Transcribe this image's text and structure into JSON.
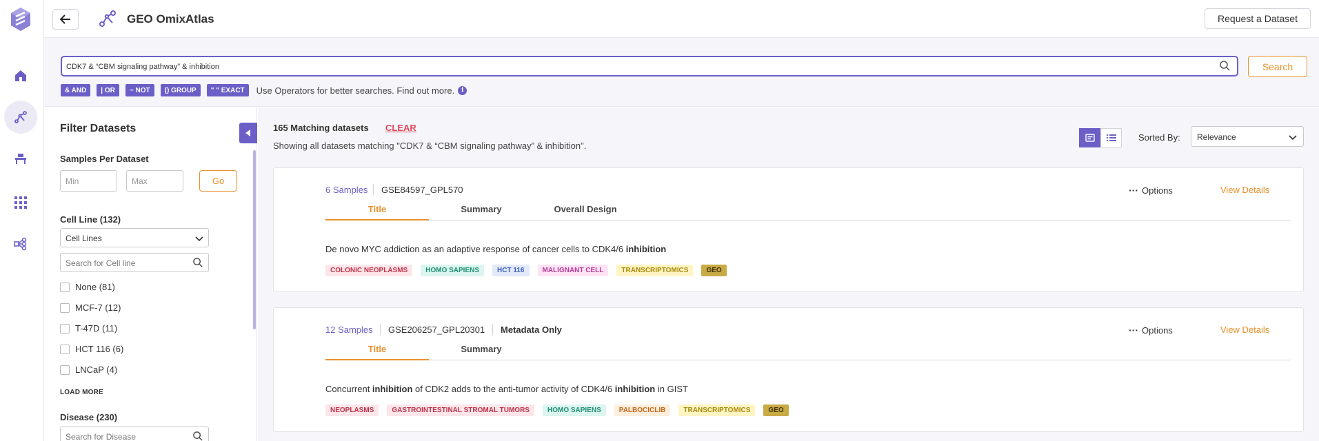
{
  "app": {
    "title": "GEO OmixAtlas",
    "request_label": "Request a Dataset"
  },
  "search": {
    "query": "CDK7 & “CBM signaling pathway” & inhibition",
    "button_label": "Search",
    "operators": [
      "& AND",
      "| OR",
      "~ NOT",
      "() GROUP",
      "\" \" EXACT"
    ],
    "hint": "Use Operators for better searches. Find out more."
  },
  "filter": {
    "title": "Filter Datasets",
    "samples_label": "Samples Per Dataset",
    "min_placeholder": "Min",
    "max_placeholder": "Max",
    "go_label": "Go",
    "cell_line": {
      "label": "Cell Line (132)",
      "select_value": "Cell Lines",
      "search_placeholder": "Search for Cell line",
      "options": [
        "None (81)",
        "MCF-7 (12)",
        "T-47D (11)",
        "HCT 116 (6)",
        "LNCaP (4)"
      ]
    },
    "load_more": "LOAD MORE",
    "disease": {
      "label": "Disease (230)",
      "search_placeholder": "Search for Disease"
    }
  },
  "results": {
    "count_label": "165 Matching datasets",
    "clear_label": "CLEAR",
    "showing": "Showing all datasets matching \"CDK7 & “CBM signaling pathway” & inhibition\".",
    "sorted_by_label": "Sorted By:",
    "sort_value": "Relevance",
    "cards": [
      {
        "samples": "6 Samples",
        "gse": "GSE84597_GPL570",
        "options": "Options",
        "details": "View Details",
        "tabs": [
          "Title",
          "Summary",
          "Overall Design"
        ],
        "desc_pre": "De novo MYC addiction as an adaptive response of cancer cells to CDK4/6 ",
        "desc_bold": "inhibition",
        "tags": [
          "COLONIC NEOPLASMS",
          "HOMO SAPIENS",
          "HCT 116",
          "MALIGNANT CELL",
          "TRANSCRIPTOMICS",
          "GEO"
        ]
      },
      {
        "samples": "12 Samples",
        "gse": "GSE206257_GPL20301",
        "meta": "Metadata Only",
        "options": "Options",
        "details": "View Details",
        "tabs": [
          "Title",
          "Summary"
        ],
        "desc_a": "Concurrent ",
        "desc_b": "inhibition",
        "desc_c": " of CDK2 adds to the anti-tumor activity of CDK4/6 ",
        "desc_d": "inhibition",
        "desc_e": " in GIST",
        "tags": [
          "NEOPLASMS",
          "GASTROINTESTINAL STROMAL TUMORS",
          "HOMO SAPIENS",
          "PALBOCICLIB",
          "TRANSCRIPTOMICS",
          "GEO"
        ]
      }
    ]
  },
  "colors": {
    "accent": "#6b5fc7",
    "orange": "#e8912b",
    "clear": "#e0465a"
  }
}
